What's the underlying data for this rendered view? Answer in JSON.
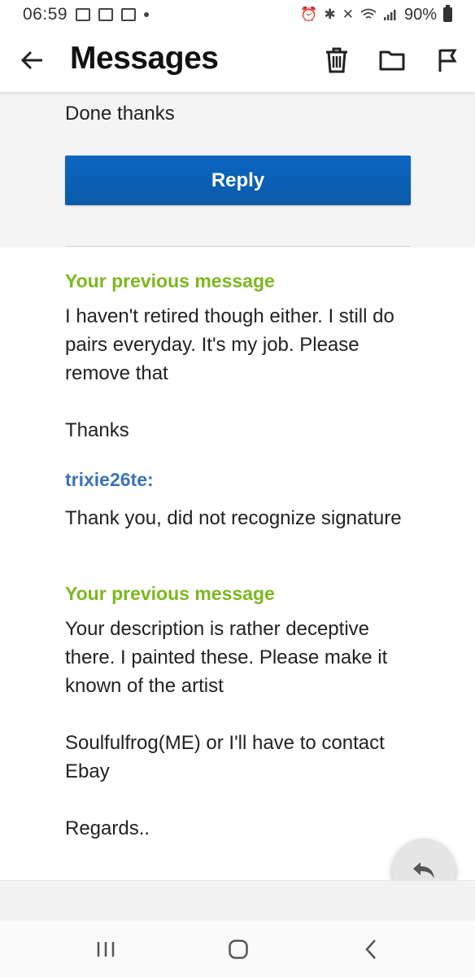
{
  "status_bar": {
    "time": "06:59",
    "battery": "90%"
  },
  "header": {
    "title": "Messages"
  },
  "current_message": {
    "text": "Done thanks",
    "reply_label": "Reply"
  },
  "thread": [
    {
      "sender": "Your previous message",
      "kind": "self",
      "text": "I haven't retired though either. I still do pairs everyday. It's my job. Please remove that\n\nThanks"
    },
    {
      "sender": "trixie26te:",
      "kind": "other",
      "text": "Thank you, did not recognize signature"
    },
    {
      "sender": "Your previous message",
      "kind": "self",
      "text": "Your description is rather deceptive there. I painted these. Please make it known of the artist\n\nSoulfulfrog(ME) or I'll have to contact Ebay\n\nRegards.."
    }
  ],
  "icons": {
    "back": "arrow-left-icon",
    "delete": "trash-icon",
    "move": "folder-icon",
    "flag": "flag-icon",
    "fab": "reply-arrow-icon",
    "nav_recents": "recents-icon",
    "nav_home": "home-icon",
    "nav_back": "nav-back-icon"
  },
  "colors": {
    "accent_green": "#7cb820",
    "accent_blue": "#3a74b8",
    "button_blue": "#0c66c2"
  }
}
